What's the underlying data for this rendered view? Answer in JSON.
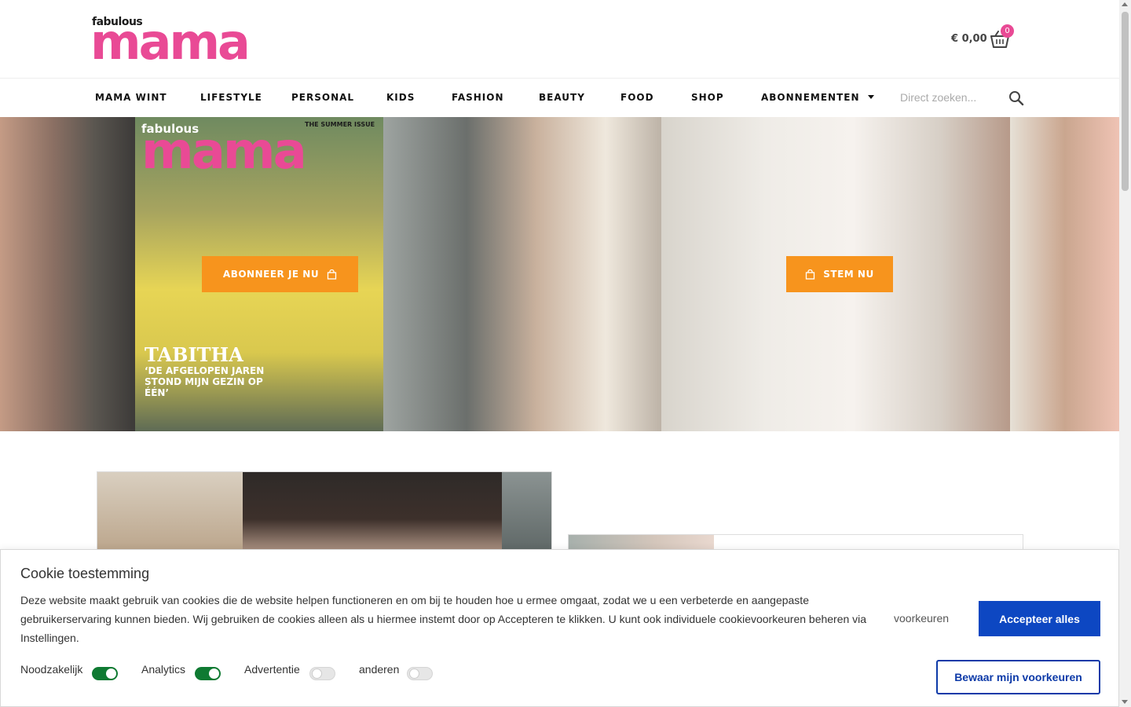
{
  "header": {
    "logo_small": "fabulous",
    "logo_big": "mama",
    "cart_amount": "€ 0,00",
    "cart_count": "0",
    "cart_icon": "basket-icon",
    "brand_color": "#e94a95"
  },
  "nav": {
    "items": [
      {
        "label": "MAMA WINT"
      },
      {
        "label": "LIFESTYLE"
      },
      {
        "label": "PERSONAL"
      },
      {
        "label": "KIDS"
      },
      {
        "label": "FASHION"
      },
      {
        "label": "BEAUTY"
      },
      {
        "label": "FOOD"
      },
      {
        "label": "SHOP"
      },
      {
        "label": "ABONNEMENTEN"
      }
    ],
    "search_placeholder": "Direct zoeken...",
    "search_icon": "search-icon"
  },
  "hero": {
    "cover_small": "fabulous",
    "cover_big": "mama",
    "cover_issue": "THE SUMMER ISSUE",
    "cover_headline": "TABITHA",
    "cover_quote": "‘De afgelopen jaren stond mijn gezin op één’",
    "subscribe_button": "ABONNEER JE NU",
    "vote_button": "STEM NU",
    "button_color": "#f7941d",
    "button_icon": "shopping-bag-icon"
  },
  "cookie": {
    "title": "Cookie toestemming",
    "text": "Deze website maakt gebruik van cookies die de website helpen functioneren en om bij te houden hoe u ermee omgaat, zodat we u een verbeterde en aangepaste gebruikerservaring kunnen bieden. Wij gebruiken de cookies alleen als u hiermee instemt door op Accepteren te klikken. U kunt ook individuele cookievoorkeuren beheren via Instellingen.",
    "preferences_link": "voorkeuren",
    "accept_all": "Accepteer alles",
    "save_preferences": "Bewaar mijn voorkeuren",
    "toggles": [
      {
        "label": "Noodzakelijk",
        "on": true
      },
      {
        "label": "Analytics",
        "on": true
      },
      {
        "label": "Advertentie",
        "on": false
      },
      {
        "label": "anderen",
        "on": false
      }
    ],
    "accept_color": "#0d47c2",
    "toggle_on_color": "#0f7a32"
  }
}
